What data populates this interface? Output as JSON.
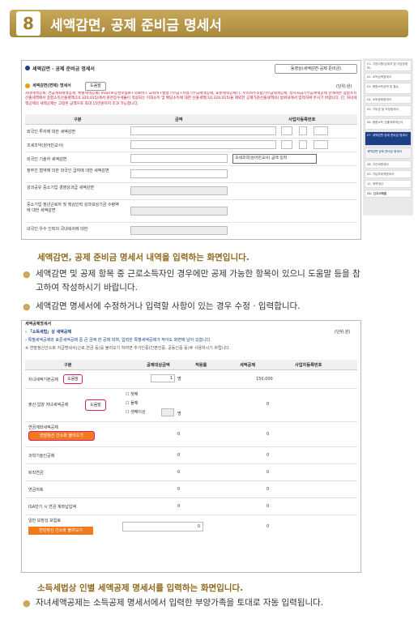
{
  "header": {
    "number": "8",
    "title": "세액감면, 공제 준비금 명세서"
  },
  "screen1": {
    "title": "세액감면 · 공제 준비금 명세서",
    "top_button": "동영상(세액감면·공제 준비금)",
    "subtitle": "세액감면(면제) 명세서",
    "help_button": "도움말",
    "unit": "(단위:원)",
    "notice": "자녀세액공제, 연금계좌세액공제, 특별세액공제( max(보장성보험료+의료비+ 교육비+법정기부금+지정기부금세액공제, 표준세액공제) ), 우리사주조합기부금세액공제, 정치자금기부금세액공제 한계액은 종합소득산출세액에서 종합소득산출세액(10,320,015)에서 원천징수세율이 적용되는 이자소득 및 배당소득에 대한 산출세액(10,320,015)을 제외한 공제가준산출세액(0) 범위내에서 입력하여 주시기 바랍니다. 단, 자녀세액공제의 세액공제는 고정된 금액으로 최대 15만원까지 조과 가능합니다.",
    "columns": [
      "구분",
      "금액",
      "사업자등록번호"
    ],
    "rows": [
      "외국인 투자에 대한 세액감면",
      "조세조약(원어민교사)",
      "외국인 기술자 세액감면",
      "정부간 협약에 의한 외국인 급여에 대한 세액감면",
      "성과공유 중소기업 경영성과급 세액감면",
      "중소기업 청년근로자 및 핵심인력 성과보상기금 수령액에 대한 세액감면",
      "내국인 우수 인력의 국내복귀에 대한"
    ],
    "tooltip": "조세조약(원어민교사) 금액 입력",
    "sidebar": [
      "01. 기본사항(납세자 및 사업장정보)",
      "02. 소득금액명세서",
      "03. 종합소득금액 및 결손",
      "04. 소득공제명세서",
      "05. 기부금 및 조정명세서",
      "06. 종합소득 산출세액계산서",
      "07. 세액감면·공제 준비금 명세서",
      "세액감면·공제 준비금 명세서",
      "08. 가산세명세서",
      "09. 기납부세액명세서",
      "10. 세액계산",
      "11. 신고서제출"
    ]
  },
  "caption1": "세액감면, 공제 준비금 명세서 내역을 입력하는 화면입니다.",
  "bullets1": [
    "세액감면 및 공제 항목 중 근로소득자인 경우에만 공제 가능한 항목이 있으니 도움말 등을 참고하여 작성하시기 바랍니다.",
    "세액감면 명세서에 수정하거나 입력할 사항이 있는 경우 수정 · 입력합니다."
  ],
  "screen2": {
    "title": "세액공제명세서",
    "sub1": "「소득세법」상 세액공제",
    "unit": "(단위:원)",
    "note1": "특별세액공제와 표준세액공제 중 큰 금액 한 공제 되며, 입력한 특별세액공제가 작아도 화면에 남아 있습니다.",
    "note2": "※ 연말정산간소화 지급명세서(근로,연금 등)를 불러오기 하려면 추가인증(간편인증, 공동인증 등)후 사용하시기 바랍니다.",
    "columns": [
      "구분",
      "공제대상금액",
      "적용률",
      "세액공제",
      "사업자등록번호"
    ],
    "help": "도움말",
    "row1": {
      "label": "자녀세액기본공제",
      "count": "1",
      "unit": "명",
      "amount": "150,000"
    },
    "row2": {
      "label": "출산·입양 자녀세액공제",
      "opt1": "첫째",
      "opt2": "둘째",
      "opt3": "셋째이상",
      "unit": "명",
      "amount": "0"
    },
    "row3": {
      "label": "연금계좌세액공제",
      "btn": "연말정산 간소화 불러오기",
      "v1": "0",
      "v2": "0"
    },
    "row4": {
      "label": "과학기술인공제",
      "v1": "0",
      "v2": "0"
    },
    "row5": {
      "label": "퇴직연금",
      "v1": "0",
      "v2": "0"
    },
    "row6": {
      "label": "연금저축",
      "v1": "0",
      "v2": "0"
    },
    "row7": {
      "label": "ISA만기 시 연금 계좌납입액",
      "v1": "0",
      "v2": "0"
    },
    "row8": {
      "label": "일반 보장성 보험료",
      "btn": "연말정산 간소화 불러오기",
      "v1": "0",
      "v2": "0"
    }
  },
  "caption2": "소득세법상 인별 세액공제 명세서를 입력하는 화면입니다.",
  "bullets2": [
    "자녀세액공제는 소득공제 명세서에서 입력한 부양가족을 토대로 자동 입력됩니다."
  ]
}
